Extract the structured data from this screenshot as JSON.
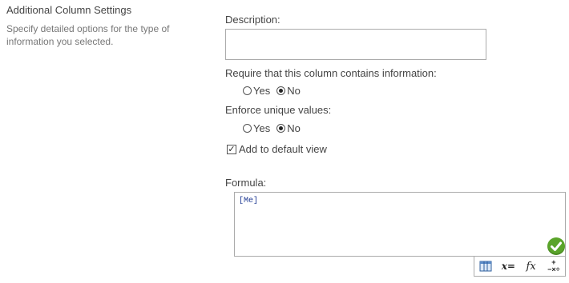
{
  "section": {
    "title": "Additional Column Settings",
    "description": "Specify detailed options for the type of information you selected."
  },
  "description_field": {
    "label": "Description:",
    "value": ""
  },
  "required": {
    "label": "Require that this column contains information:",
    "options": [
      {
        "label": "Yes",
        "checked": false
      },
      {
        "label": "No",
        "checked": true
      }
    ]
  },
  "unique": {
    "label": "Enforce unique values:",
    "options": [
      {
        "label": "Yes",
        "checked": false
      },
      {
        "label": "No",
        "checked": true
      }
    ]
  },
  "default_view": {
    "label": "Add to default view",
    "checked": true
  },
  "formula": {
    "label": "Formula:",
    "value": "[Me]"
  },
  "formula_toolbar": {
    "icons": [
      "insert-column-icon",
      "insert-variable-icon",
      "insert-function-icon",
      "operators-icon"
    ],
    "fx_glyph": "fx",
    "operators_glyph": "+−×÷",
    "variable_glyph": "x="
  },
  "colors": {
    "ok_green": "#5aa42a",
    "formula_text": "#1f3a93"
  }
}
